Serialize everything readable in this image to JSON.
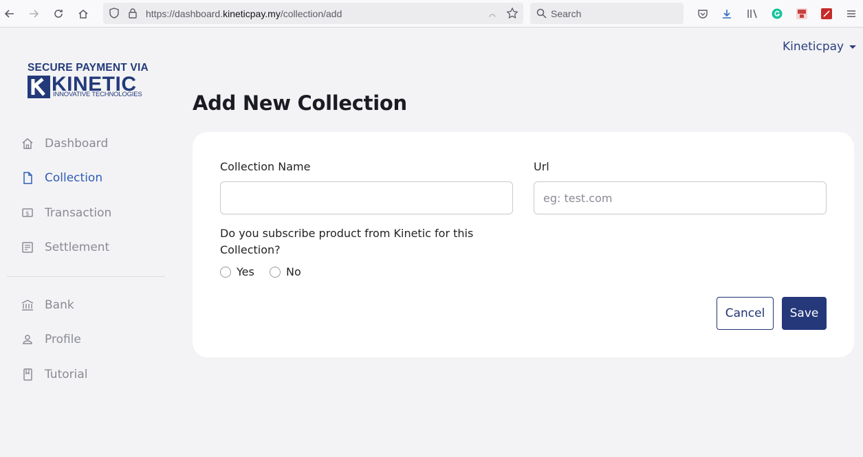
{
  "browser": {
    "url_prefix": "https://dashboard.",
    "url_domain": "kineticpay.my",
    "url_path": "/collection/add",
    "search_placeholder": "Search"
  },
  "logo": {
    "line1": "SECURE PAYMENT VIA",
    "brand": "KINETIC",
    "tagline": "INNOVATIVE TECHNOLOGIES"
  },
  "sidebar": {
    "items": [
      {
        "label": "Dashboard",
        "icon": "home-icon"
      },
      {
        "label": "Collection",
        "icon": "document-icon"
      },
      {
        "label": "Transaction",
        "icon": "money-icon"
      },
      {
        "label": "Settlement",
        "icon": "receipt-icon"
      },
      {
        "label": "Bank",
        "icon": "bank-icon"
      },
      {
        "label": "Profile",
        "icon": "user-icon"
      },
      {
        "label": "Tutorial",
        "icon": "book-icon"
      }
    ],
    "active": "Collection"
  },
  "header": {
    "user": "Kineticpay"
  },
  "page": {
    "title": "Add New Collection"
  },
  "form": {
    "collection_name_label": "Collection Name",
    "collection_name_value": "",
    "url_label": "Url",
    "url_placeholder": "eg: test.com",
    "question": "Do you subscribe product from Kinetic for this Collection?",
    "option_yes": "Yes",
    "option_no": "No",
    "cancel_label": "Cancel",
    "save_label": "Save"
  },
  "colors": {
    "primary": "#24387a",
    "active_nav": "#2f5cb5",
    "muted_nav": "#8a8a95",
    "background": "#f3f3f5"
  }
}
